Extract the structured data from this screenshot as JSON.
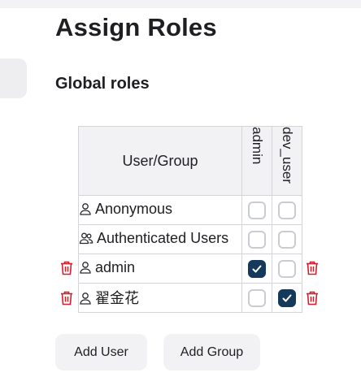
{
  "page_title": "Assign Roles",
  "section_title": "Global roles",
  "table": {
    "user_header": "User/Group",
    "roles": [
      "admin",
      "dev_user"
    ],
    "rows": [
      {
        "name": "Anonymous",
        "type": "user-icon",
        "checks": [
          false,
          false
        ],
        "deletable": false
      },
      {
        "name": "Authenticated Users",
        "type": "group-icon",
        "checks": [
          false,
          false
        ],
        "deletable": false
      },
      {
        "name": "admin",
        "type": "user-icon",
        "checks": [
          true,
          false
        ],
        "deletable": true
      },
      {
        "name": "翟金花",
        "type": "user-icon",
        "checks": [
          false,
          true
        ],
        "deletable": true
      }
    ]
  },
  "buttons": {
    "add_user": "Add User",
    "add_group": "Add Group"
  },
  "colors": {
    "checked": "#14395a",
    "delete": "#d0202e"
  }
}
